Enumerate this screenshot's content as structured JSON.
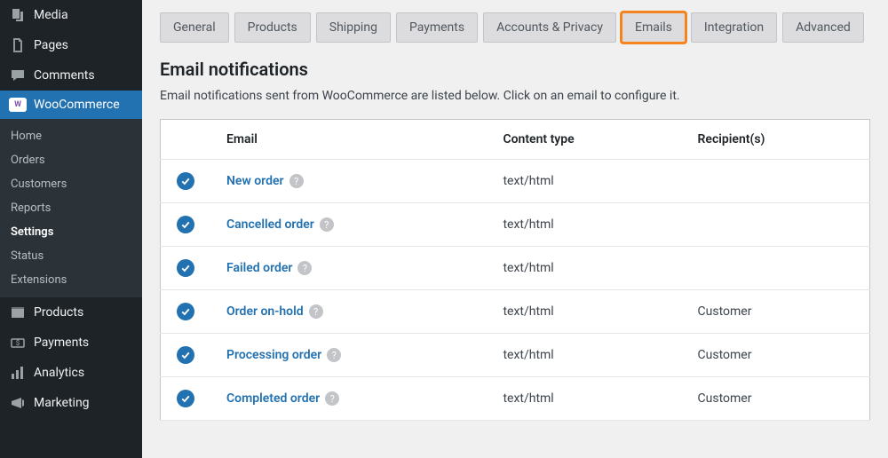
{
  "sidebar": {
    "admin_items": [
      {
        "label": "Media",
        "icon": "media"
      },
      {
        "label": "Pages",
        "icon": "pages"
      },
      {
        "label": "Comments",
        "icon": "comments"
      }
    ],
    "woocommerce": {
      "label": "WooCommerce",
      "icon": "woo"
    },
    "woo_sub": [
      {
        "label": "Home"
      },
      {
        "label": "Orders"
      },
      {
        "label": "Customers"
      },
      {
        "label": "Reports"
      },
      {
        "label": "Settings",
        "current": true
      },
      {
        "label": "Status"
      },
      {
        "label": "Extensions"
      }
    ],
    "rest": [
      {
        "label": "Products",
        "icon": "products"
      },
      {
        "label": "Payments",
        "icon": "payments"
      },
      {
        "label": "Analytics",
        "icon": "analytics"
      },
      {
        "label": "Marketing",
        "icon": "marketing"
      }
    ]
  },
  "tabs": [
    {
      "label": "General"
    },
    {
      "label": "Products"
    },
    {
      "label": "Shipping"
    },
    {
      "label": "Payments"
    },
    {
      "label": "Accounts & Privacy"
    },
    {
      "label": "Emails",
      "highlight": true
    },
    {
      "label": "Integration"
    },
    {
      "label": "Advanced"
    }
  ],
  "section": {
    "title": "Email notifications",
    "description": "Email notifications sent from WooCommerce are listed below. Click on an email to configure it."
  },
  "table": {
    "headers": {
      "email": "Email",
      "content_type": "Content type",
      "recipients": "Recipient(s)"
    },
    "rows": [
      {
        "name": "New order",
        "content_type": "text/html",
        "recipients": ""
      },
      {
        "name": "Cancelled order",
        "content_type": "text/html",
        "recipients": ""
      },
      {
        "name": "Failed order",
        "content_type": "text/html",
        "recipients": ""
      },
      {
        "name": "Order on-hold",
        "content_type": "text/html",
        "recipients": "Customer"
      },
      {
        "name": "Processing order",
        "content_type": "text/html",
        "recipients": "Customer"
      },
      {
        "name": "Completed order",
        "content_type": "text/html",
        "recipients": "Customer"
      }
    ]
  }
}
